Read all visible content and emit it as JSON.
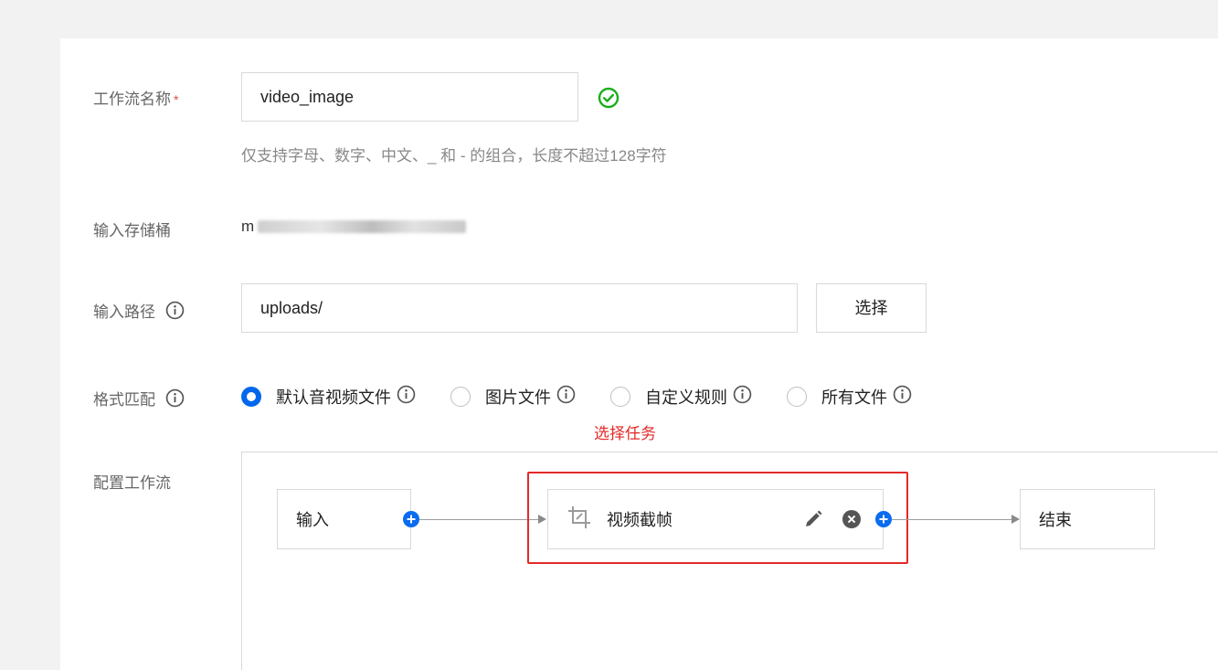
{
  "form": {
    "workflow_name": {
      "label": "工作流名称",
      "required_mark": "*",
      "value": "video_image",
      "hint": "仅支持字母、数字、中文、_ 和 - 的组合，长度不超过128字符",
      "valid": true
    },
    "input_bucket": {
      "label": "输入存储桶",
      "value_prefix": "m"
    },
    "input_path": {
      "label": "输入路径",
      "value": "uploads/",
      "select_button": "选择"
    },
    "format_match": {
      "label": "格式匹配",
      "options": [
        {
          "label": "默认音视频文件",
          "checked": true
        },
        {
          "label": "图片文件",
          "checked": false
        },
        {
          "label": "自定义规则",
          "checked": false
        },
        {
          "label": "所有文件",
          "checked": false
        }
      ]
    },
    "configure_workflow": {
      "label": "配置工作流"
    }
  },
  "annotation": {
    "text": "选择任务",
    "color": "#e22a2a"
  },
  "workflow": {
    "nodes": [
      {
        "label": "输入"
      },
      {
        "label": "视频截帧",
        "icon": "crop-icon"
      },
      {
        "label": "结束"
      }
    ]
  },
  "colors": {
    "primary": "#0067ed",
    "success": "#1aad19",
    "danger": "#e22a2a"
  }
}
